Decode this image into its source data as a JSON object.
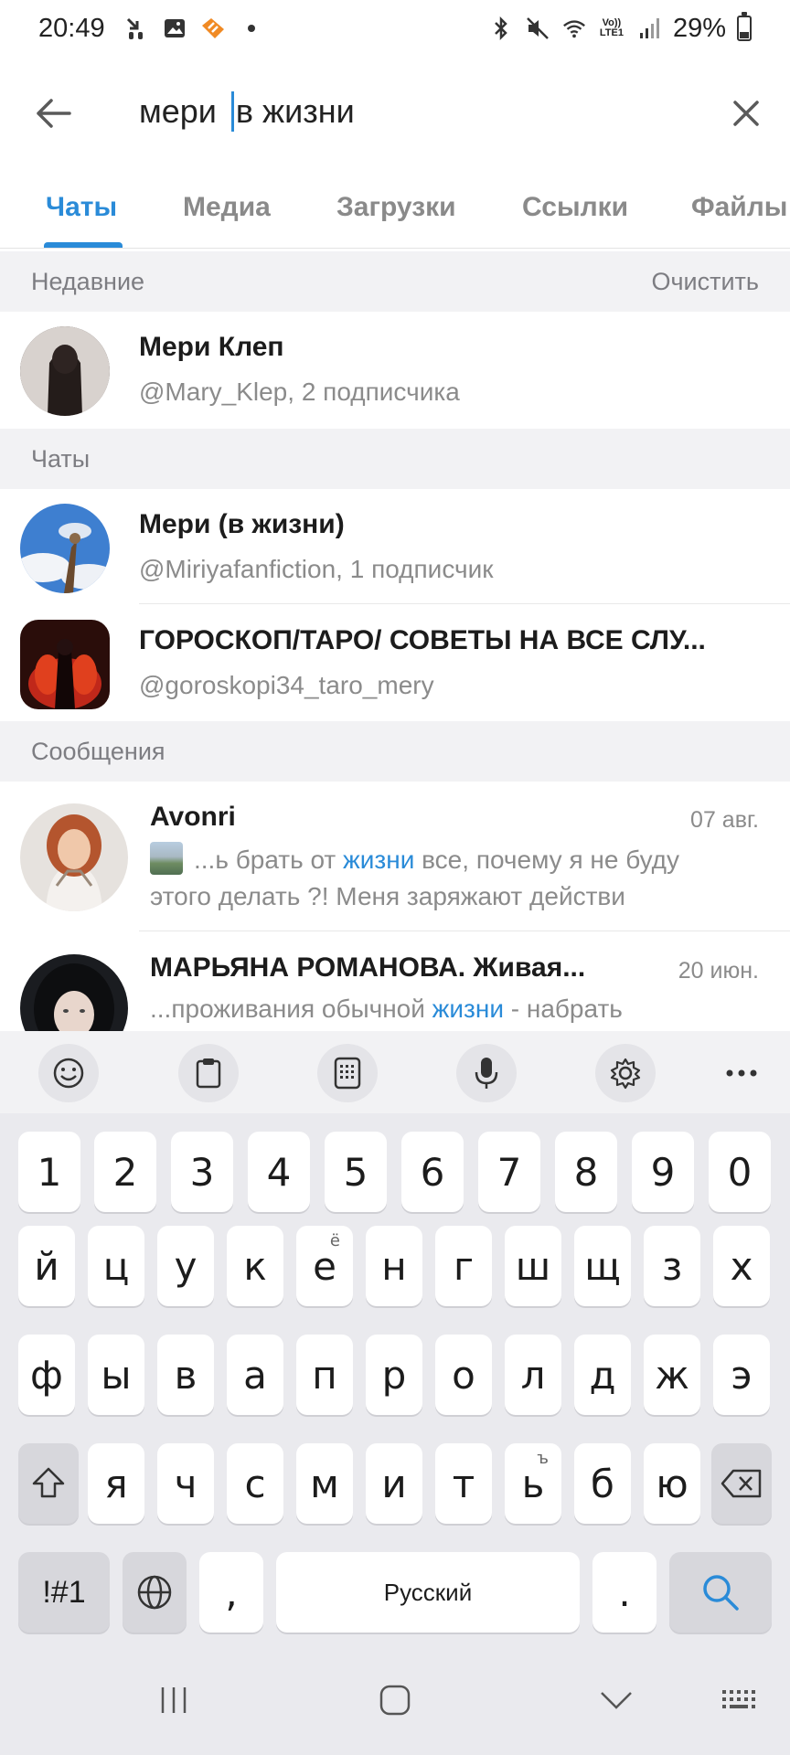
{
  "status_bar": {
    "time": "20:49",
    "battery": "29%",
    "battery_level": 0.29,
    "icons": [
      "missed-call-icon",
      "gallery-icon",
      "app-notification-icon",
      "dot-icon",
      "bluetooth-icon",
      "mute-icon",
      "wifi-icon",
      "volte-icon",
      "signal-icon",
      "battery-icon"
    ],
    "volte_label": "Vo)) LTE1"
  },
  "search": {
    "query_before_cursor": "мери ",
    "query_after_cursor": "в жизни"
  },
  "tabs": [
    {
      "label": "Чаты",
      "active": true
    },
    {
      "label": "Медиа",
      "active": false
    },
    {
      "label": "Загрузки",
      "active": false
    },
    {
      "label": "Ссылки",
      "active": false
    },
    {
      "label": "Файлы",
      "active": false
    }
  ],
  "recent": {
    "header": "Недавние",
    "clear_label": "Очистить",
    "items": [
      {
        "title": "Мери Клеп",
        "subtitle": "@Mary_Klep, 2 подписчика"
      }
    ]
  },
  "chats": {
    "header": "Чаты",
    "items": [
      {
        "title": "Мери (в жизни)",
        "subtitle": "@Miriyafanfiction, 1 подписчик"
      },
      {
        "title": "ГОРОСКОП/ТАРО/ СОВЕТЫ НА ВСЕ СЛУ...",
        "subtitle": "@goroskopi34_taro_mery"
      }
    ]
  },
  "messages": {
    "header": "Сообщения",
    "items": [
      {
        "title": "Avonri",
        "date": "07 авг.",
        "line1_before": "...ь брать от ",
        "line1_highlight": "жизни",
        "line1_after": " все, почему я не буду",
        "line2": "этого делать ?! Меня заряжают действи"
      },
      {
        "title": "МАРЬЯНА РОМАНОВА. Живая...",
        "date": "20 июн.",
        "line1_before": "...проживания обычной ",
        "line1_highlight": "жизни",
        "line1_after": " - набрать"
      }
    ]
  },
  "keyboard": {
    "toolbar": [
      "emoji-icon",
      "clipboard-icon",
      "keypad-icon",
      "microphone-icon",
      "settings-icon",
      "more-icon"
    ],
    "row_numbers": [
      "1",
      "2",
      "3",
      "4",
      "5",
      "6",
      "7",
      "8",
      "9",
      "0"
    ],
    "row1": [
      "й",
      "ц",
      "у",
      "к",
      "е",
      "н",
      "г",
      "ш",
      "щ",
      "з",
      "х"
    ],
    "row1_sub_e": "ё",
    "row2": [
      "ф",
      "ы",
      "в",
      "а",
      "п",
      "р",
      "о",
      "л",
      "д",
      "ж",
      "э"
    ],
    "row3": [
      "я",
      "ч",
      "с",
      "м",
      "и",
      "т",
      "ь",
      "б",
      "ю"
    ],
    "row3_sub_soft": "ъ",
    "symbols_label": "!#1",
    "comma_label": ",",
    "space_label": "Русский",
    "period_label": ".",
    "accent_color": "#2a8bd8"
  },
  "nav_bar": [
    "recents-icon",
    "home-icon",
    "back-icon",
    "keyboard-switch-icon"
  ]
}
